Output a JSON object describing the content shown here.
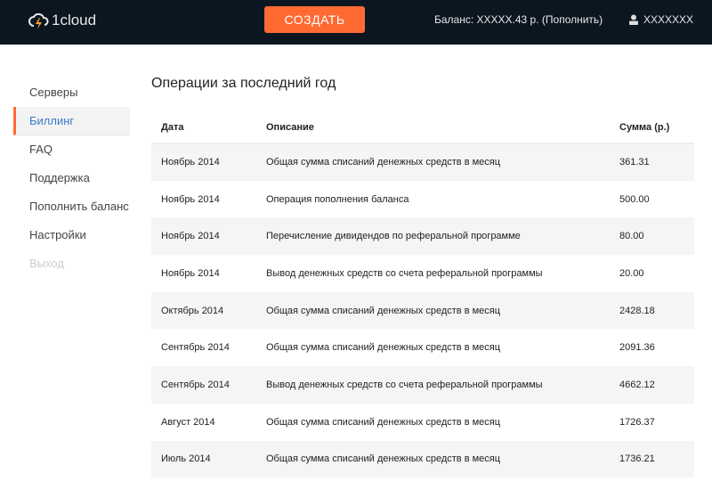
{
  "header": {
    "logo": "1cloud",
    "create_label": "СОЗДАТЬ",
    "balance": "Баланс: XXXXX.43 р. (Пополнить)",
    "user": "XXXXXXX"
  },
  "sidebar": {
    "items": [
      {
        "label": "Серверы"
      },
      {
        "label": "Биллинг"
      },
      {
        "label": "FAQ"
      },
      {
        "label": "Поддержка"
      },
      {
        "label": "Пополнить баланс"
      },
      {
        "label": "Настройки"
      },
      {
        "label": "Выход"
      }
    ]
  },
  "main": {
    "title": "Операции за последний год",
    "columns": [
      "Дата",
      "Описание",
      "Сумма (р.)"
    ],
    "rows": [
      [
        "Ноябрь 2014",
        "Общая сумма списаний денежных средств в месяц",
        "361.31"
      ],
      [
        "Ноябрь 2014",
        "Операция пополнения баланса",
        "500.00"
      ],
      [
        "Ноябрь 2014",
        "Перечисление дивидендов по реферальной программе",
        "80.00"
      ],
      [
        "Ноябрь 2014",
        "Вывод денежных средств со счета реферальной программы",
        "20.00"
      ],
      [
        "Октябрь 2014",
        "Общая сумма списаний денежных средств в месяц",
        "2428.18"
      ],
      [
        "Сентябрь 2014",
        "Общая сумма списаний денежных средств в месяц",
        "2091.36"
      ],
      [
        "Сентябрь 2014",
        "Вывод денежных средств со счета реферальной программы",
        "4662.12"
      ],
      [
        "Август 2014",
        "Общая сумма списаний денежных средств в месяц",
        "1726.37"
      ],
      [
        "Июль 2014",
        "Общая сумма списаний денежных средств в месяц",
        "1736.21"
      ]
    ]
  }
}
